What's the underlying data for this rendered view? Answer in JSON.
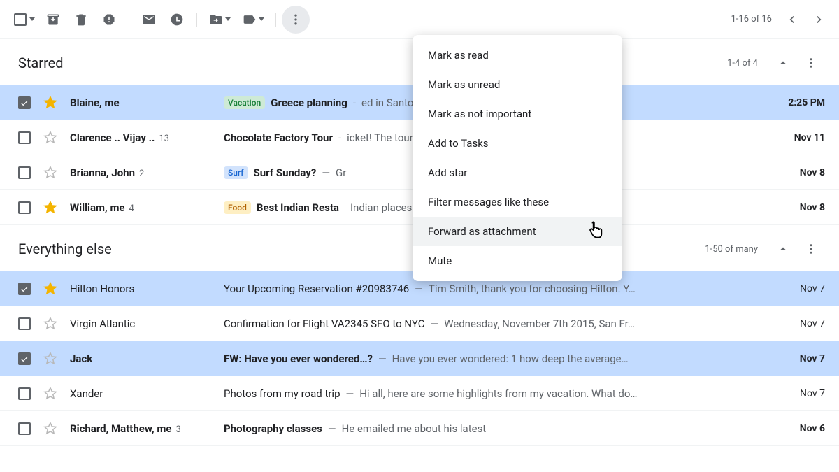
{
  "toolbar": {
    "page_info": "1-16 of 16"
  },
  "sections": {
    "starred": {
      "title": "Starred",
      "count": "1-4 of 4"
    },
    "else": {
      "title": "Everything else",
      "count": "1-50 of many"
    }
  },
  "menu": {
    "items": [
      "Mark as read",
      "Mark as unread",
      "Mark as not important",
      "Add to Tasks",
      "Add star",
      "Filter messages like these",
      "Forward as attachment",
      "Mute"
    ],
    "hovered_index": 6
  },
  "labels": {
    "vacation": {
      "text": "Vacation",
      "bg": "#ceead6",
      "fg": "#188038"
    },
    "surf": {
      "text": "Surf",
      "bg": "#d2e3fc",
      "fg": "#1967d2"
    },
    "food": {
      "text": "Food",
      "bg": "#feefc3",
      "fg": "#b06000"
    }
  },
  "rows": [
    {
      "sender": "Blaine, me",
      "count": "",
      "label": "vacation",
      "subject": "Greece planning",
      "sep": " - ",
      "snippet": "ed in Santorini for the...",
      "date": "2:25 PM",
      "selected": true,
      "starred": true,
      "unread": true
    },
    {
      "sender": "Clarence .. Vijay ..",
      "count": "13",
      "label": null,
      "subject": "Chocolate Factory Tour",
      "sep": " - ",
      "snippet": "icket! The tour begins...",
      "date": "Nov 11",
      "selected": false,
      "starred": false,
      "unread": true
    },
    {
      "sender": "Brianna, John",
      "count": "2",
      "label": "surf",
      "subject": "Surf Sunday?",
      "sep": " — ",
      "snippet": "Gr",
      "date": "Nov 8",
      "selected": false,
      "starred": false,
      "unread": true
    },
    {
      "sender": "William, me",
      "count": "4",
      "label": "food",
      "subject": "Best Indian Resta",
      "sep": "",
      "snippet": " Indian places in the...",
      "date": "Nov 8",
      "selected": false,
      "starred": true,
      "unread": true
    },
    {
      "sender": "Hilton Honors",
      "count": "",
      "label": null,
      "subject": "Your Upcoming Reservation #20983746",
      "sep": " — ",
      "snippet": "Tim Smith, thank you for choosing Hilton. Y…",
      "date": "Nov 7",
      "selected": true,
      "starred": true,
      "unread": false
    },
    {
      "sender": "Virgin Atlantic",
      "count": "",
      "label": null,
      "subject": "Confirmation for Flight VA2345 SFO to NYC",
      "sep": " — ",
      "snippet": "Wednesday, November 7th 2015, San Fr…",
      "date": "Nov 7",
      "selected": false,
      "starred": false,
      "unread": false
    },
    {
      "sender": "Jack",
      "count": "",
      "label": null,
      "subject": "FW: Have you ever wondered…?",
      "sep": " — ",
      "snippet": "Have you ever wondered: 1 how deep the average…",
      "date": "Nov 7",
      "selected": true,
      "starred": false,
      "unread": true
    },
    {
      "sender": "Xander",
      "count": "",
      "label": null,
      "subject": "Photos from my road trip",
      "sep": " — ",
      "snippet": "Hi all, here are some highlights from my vacation. What do…",
      "date": "Nov 7",
      "selected": false,
      "starred": false,
      "unread": false
    },
    {
      "sender": "Richard, Matthew, me",
      "count": "3",
      "label": null,
      "subject": "Photography classes",
      "sep": " — ",
      "snippet": "He emailed me about his latest",
      "date": "Nov 6",
      "selected": false,
      "starred": false,
      "unread": true
    }
  ]
}
